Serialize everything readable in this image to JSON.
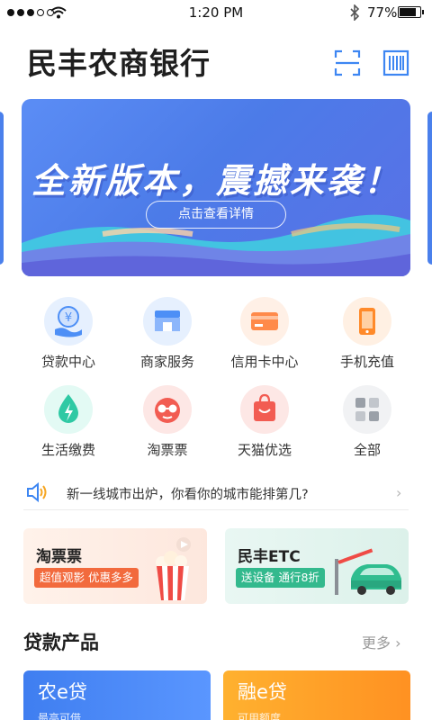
{
  "status_bar": {
    "time": "1:20 PM",
    "battery": "77%",
    "battery_level": 0.77,
    "signal_bars_filled": 3,
    "signal_bars_total": 5
  },
  "header": {
    "title": "民丰农商银行",
    "icons": [
      "scan-icon",
      "barcode-icon"
    ]
  },
  "banner": {
    "headline": "全新版本，震撼来袭！",
    "cta": "点击查看详情"
  },
  "services": [
    {
      "label": "贷款中心",
      "icon": "loan-icon",
      "color": "#4d8ff6"
    },
    {
      "label": "商家服务",
      "icon": "shop-icon",
      "color": "#4d8ff6"
    },
    {
      "label": "信用卡中心",
      "icon": "credit-card-icon",
      "color": "#ff8a4a"
    },
    {
      "label": "手机充值",
      "icon": "phone-icon",
      "color": "#ff8a2a"
    },
    {
      "label": "生活缴费",
      "icon": "utility-icon",
      "color": "#2fc9a4"
    },
    {
      "label": "淘票票",
      "icon": "movie-ticket-icon",
      "color": "#f25c52"
    },
    {
      "label": "天猫优选",
      "icon": "shopping-bag-icon",
      "color": "#f25c52"
    },
    {
      "label": "全部",
      "icon": "grid-icon",
      "color": "#9aa0a8"
    }
  ],
  "notice": {
    "text": "新一线城市出炉，你看你的城市能排第几?",
    "icon": "speaker-icon"
  },
  "promos": [
    {
      "title": "淘票票",
      "tag": "超值观影 优惠多多",
      "color": "#f26a3d"
    },
    {
      "title": "民丰ETC",
      "tag": "送设备 通行8折",
      "color": "#33b98d"
    }
  ],
  "loans": {
    "section_title": "贷款产品",
    "more": "更多",
    "cards": [
      {
        "name": "农e贷",
        "sub": "最高可借"
      },
      {
        "name": "融e贷",
        "sub": "可用额度"
      }
    ]
  },
  "colors": {
    "primary": "#4c7be8",
    "text": "#222222",
    "accent_orange": "#ff9122"
  }
}
